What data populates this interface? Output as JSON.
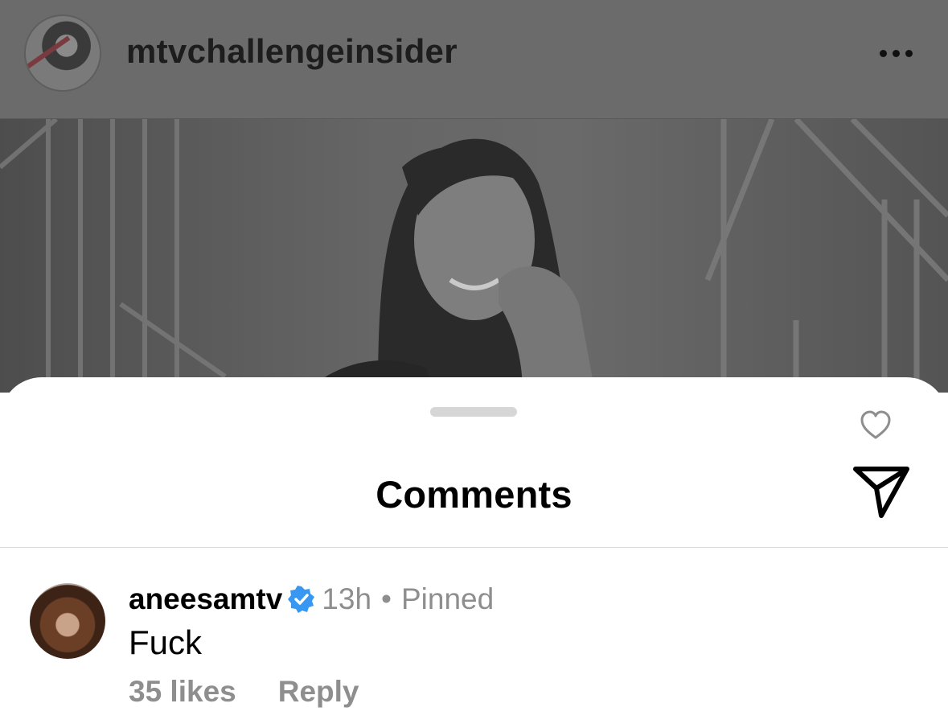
{
  "post": {
    "username": "mtvchallengeinsider",
    "more_icon": "ellipsis-icon"
  },
  "sheet": {
    "title": "Comments",
    "share_icon": "paper-plane-icon"
  },
  "comment": {
    "username": "aneesamtv",
    "verified": true,
    "verified_color": "#3897f0",
    "time": "13h",
    "separator": "•",
    "status": "Pinned",
    "text": "Fuck",
    "likes": "35 likes",
    "reply_label": "Reply",
    "like_icon": "heart-outline-icon"
  }
}
